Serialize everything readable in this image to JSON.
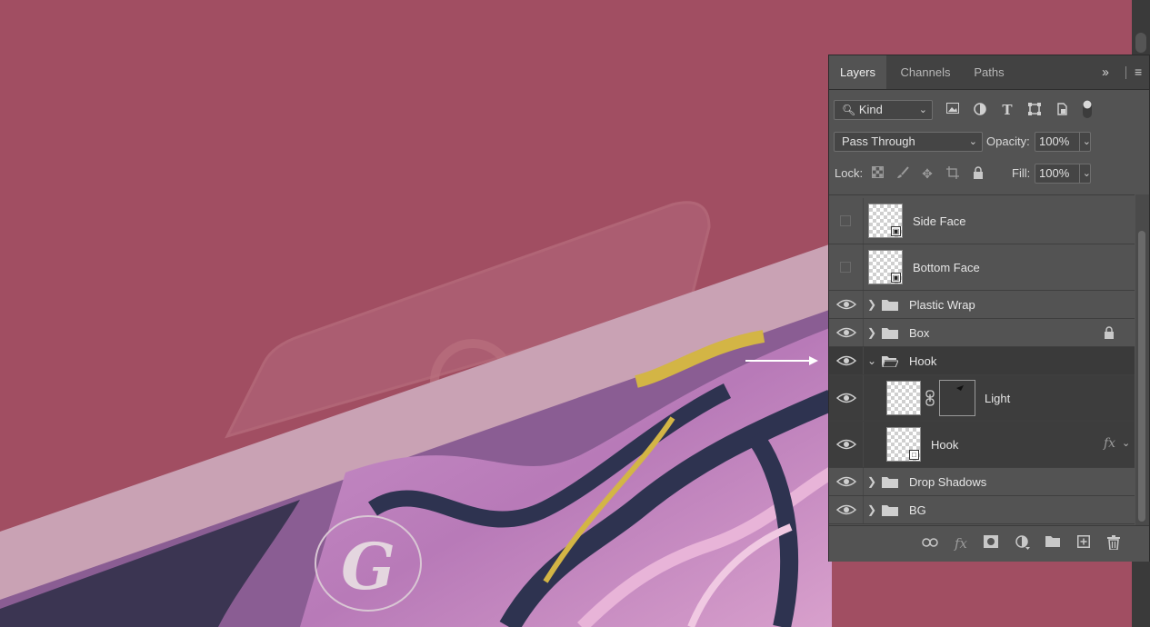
{
  "colors": {
    "background": "#a14e62",
    "panel": "#535353",
    "tab_bar": "#424242",
    "selected_row": "#3a3a3a"
  },
  "panel_tabs": [
    {
      "label": "Layers",
      "active": true
    },
    {
      "label": "Channels",
      "active": false
    },
    {
      "label": "Paths",
      "active": false
    }
  ],
  "filter": {
    "kind_label": "Kind",
    "icons": [
      "image-filter-icon",
      "adjustment-filter-icon",
      "type-filter-icon",
      "shape-filter-icon",
      "smart-object-filter-icon",
      "filter-toggle-icon"
    ]
  },
  "blend": {
    "mode": "Pass Through",
    "opacity_label": "Opacity:",
    "opacity_value": "100%",
    "lock_label": "Lock:",
    "fill_label": "Fill:",
    "fill_value": "100%"
  },
  "layers": [
    {
      "name": "Side Face",
      "type": "smart-object",
      "visible": false
    },
    {
      "name": "Bottom Face",
      "type": "smart-object",
      "visible": false
    },
    {
      "name": "Plastic Wrap",
      "type": "group",
      "visible": true,
      "expanded": false
    },
    {
      "name": "Box",
      "type": "group",
      "visible": true,
      "expanded": false,
      "locked": true
    },
    {
      "name": "Hook",
      "type": "group",
      "visible": true,
      "expanded": true
    },
    {
      "name": "Light",
      "type": "layer-with-mask",
      "visible": true,
      "indent": 1
    },
    {
      "name": "Hook",
      "type": "shape",
      "visible": true,
      "indent": 1,
      "fx": "fx"
    },
    {
      "name": "Drop Shadows",
      "type": "group",
      "visible": true,
      "expanded": false
    },
    {
      "name": "BG",
      "type": "group",
      "visible": true,
      "expanded": false
    }
  ],
  "bottom_icons": [
    "link-layers-icon",
    "fx-icon",
    "add-mask-icon",
    "adjustment-layer-icon",
    "new-group-icon",
    "new-layer-icon",
    "delete-icon"
  ],
  "fx_label": "fx",
  "canvas": {
    "logo_glyph": "G"
  }
}
